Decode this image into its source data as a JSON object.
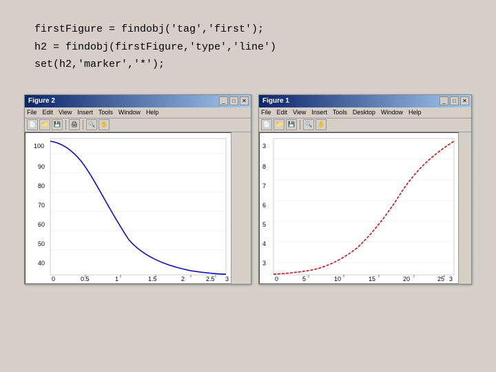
{
  "code": {
    "line1": "firstFigure = findobj('tag','first');",
    "line2": "h2 = findobj(firstFigure,'type','line')",
    "line3": "set(h2,'marker','*');"
  },
  "figure2": {
    "title": "Figure 2",
    "menus": [
      "File",
      "Edit",
      "View",
      "Insert",
      "Tools",
      "Window",
      "Help"
    ],
    "controls": [
      "_",
      "□",
      "✕"
    ]
  },
  "figure1": {
    "title": "Figure 1",
    "menus": [
      "File",
      "Edit",
      "View",
      "Insert",
      "Tools",
      "Desktop",
      "Window",
      "Help"
    ],
    "controls": [
      "_",
      "□",
      "✕"
    ]
  }
}
